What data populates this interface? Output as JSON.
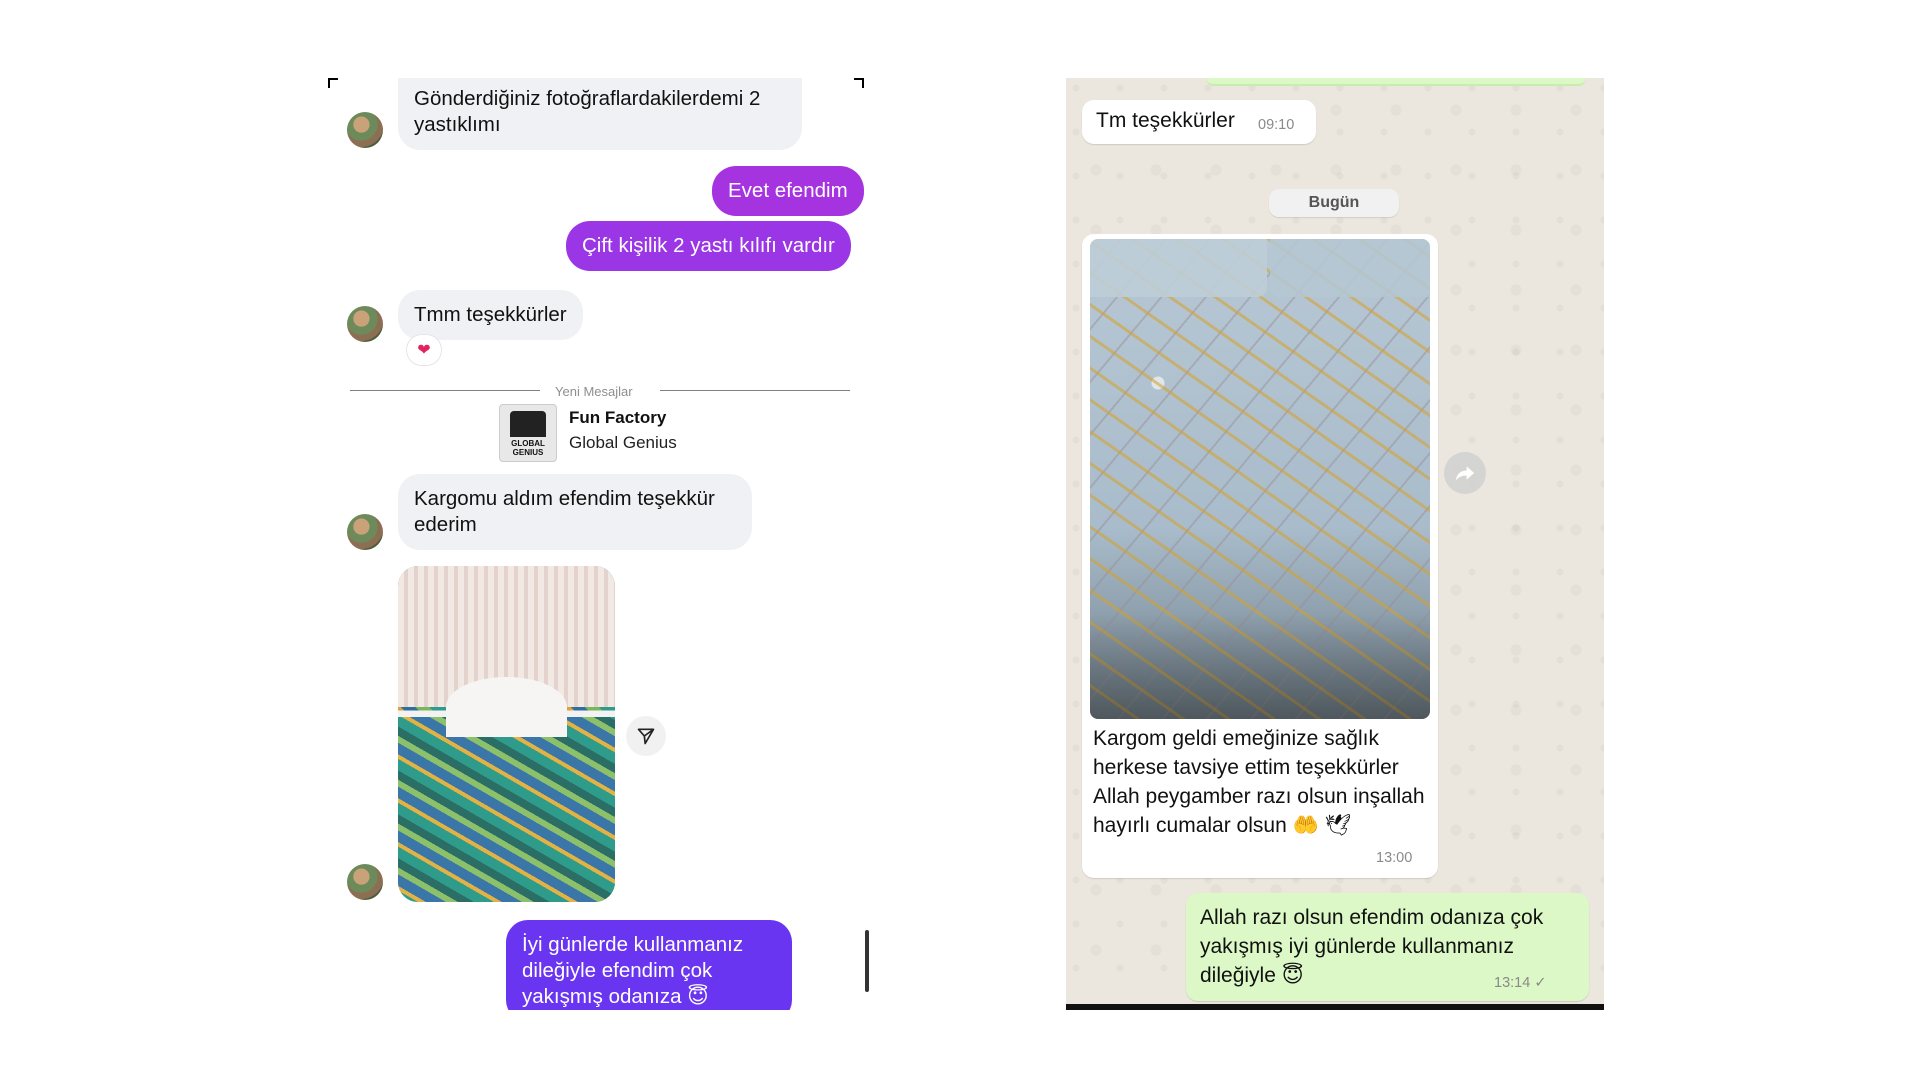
{
  "instagram": {
    "messages": [
      {
        "text": "Gönderdiğiniz fotoğraflardakilerdemi 2 yastıklımı"
      },
      {
        "text": "Evet efendim"
      },
      {
        "text": "Çift kişilik 2 yastı kılıfı vardır"
      },
      {
        "text": "Tmm teşekkürler"
      },
      {
        "text": "Kargomu aldım efendim teşekkür ederim"
      },
      {
        "text": "İyi günlerde kullanmanız dileğiyle efendim çok yakışmış odanıza 😇"
      }
    ],
    "reaction": "❤",
    "divider_label": "Yeni Mesajlar",
    "shared_account": {
      "name": "Fun Factory",
      "subtitle": "Global Genius",
      "logo_text": "GLOBAL GENIUS"
    },
    "colors": {
      "incoming_bg": "#eff1f4",
      "outgoing_purple": "#a534e0",
      "outgoing_violet": "#6a35f0"
    }
  },
  "whatsapp": {
    "messages": [
      {
        "text": "Tm teşekkürler",
        "time": "09:10"
      },
      {
        "caption": "Kargom geldi emeğinize sağlık herkese tavsiye ettim teşekkürler Allah peygamber razı olsun inşallah hayırlı cumalar olsun 🤲 🕊",
        "time": "13:00"
      },
      {
        "text": "Allah razı olsun efendim odanıza çok yakışmış iyi günlerde kullanmanız dileğiyle 😇",
        "time": "13:14 ✓"
      }
    ],
    "date_chip": "Bugün",
    "colors": {
      "incoming_bg": "#ffffff",
      "outgoing_bg": "#dcf8c6",
      "wallpaper": "#ebe6de"
    }
  }
}
